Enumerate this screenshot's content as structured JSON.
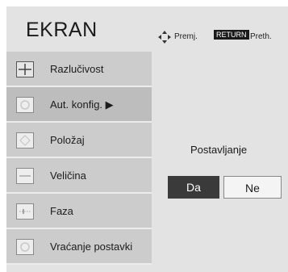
{
  "header": {
    "title": "EKRAN",
    "hint_move_icon": "move-arrows-icon",
    "hint_move_label": "Premj.",
    "return_badge": "RETURN",
    "return_label": "Preth."
  },
  "menu": {
    "items": [
      {
        "label": "Razlučivost",
        "icon": "resolution-icon"
      },
      {
        "label": "Aut. konfig. ▶",
        "icon": "auto-config-icon",
        "selected": true
      },
      {
        "label": "Položaj",
        "icon": "position-icon"
      },
      {
        "label": "Veličina",
        "icon": "size-icon"
      },
      {
        "label": "Faza",
        "icon": "phase-icon"
      },
      {
        "label": "Vraćanje postavki",
        "icon": "reset-icon"
      }
    ]
  },
  "panel": {
    "title": "Postavljanje",
    "yes_label": "Da",
    "no_label": "Ne"
  },
  "colors": {
    "background": "#e3e3e3",
    "menu_item": "#cccccc",
    "selected_button": "#3a3a3a",
    "unselected_button": "#f4f4f4"
  }
}
